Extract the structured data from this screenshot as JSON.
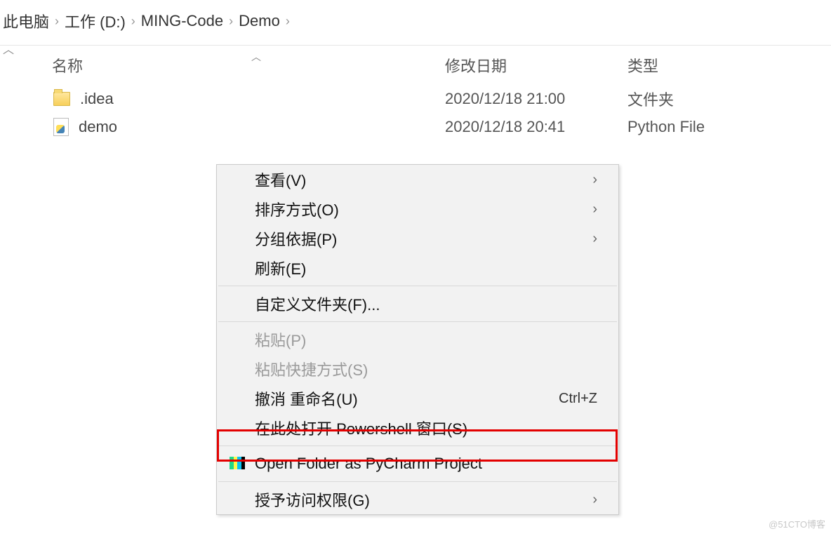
{
  "breadcrumb": [
    "此电脑",
    "工作 (D:)",
    "MING-Code",
    "Demo"
  ],
  "columns": {
    "name": "名称",
    "modified": "修改日期",
    "type": "类型"
  },
  "files": [
    {
      "name": ".idea",
      "modified": "2020/12/18 21:00",
      "type": "文件夹",
      "icon": "folder"
    },
    {
      "name": "demo",
      "modified": "2020/12/18 20:41",
      "type": "Python File",
      "icon": "pyfile"
    }
  ],
  "context_menu": {
    "view": "查看(V)",
    "sort": "排序方式(O)",
    "group": "分组依据(P)",
    "refresh": "刷新(E)",
    "customize": "自定义文件夹(F)...",
    "paste": "粘贴(P)",
    "paste_shortcut": "粘贴快捷方式(S)",
    "undo": "撤消 重命名(U)",
    "undo_shortcut": "Ctrl+Z",
    "powershell": "在此处打开 Powershell 窗口(S)",
    "pycharm": "Open Folder as PyCharm Project",
    "share": "授予访问权限(G)"
  },
  "watermark": "@51CTO博客"
}
